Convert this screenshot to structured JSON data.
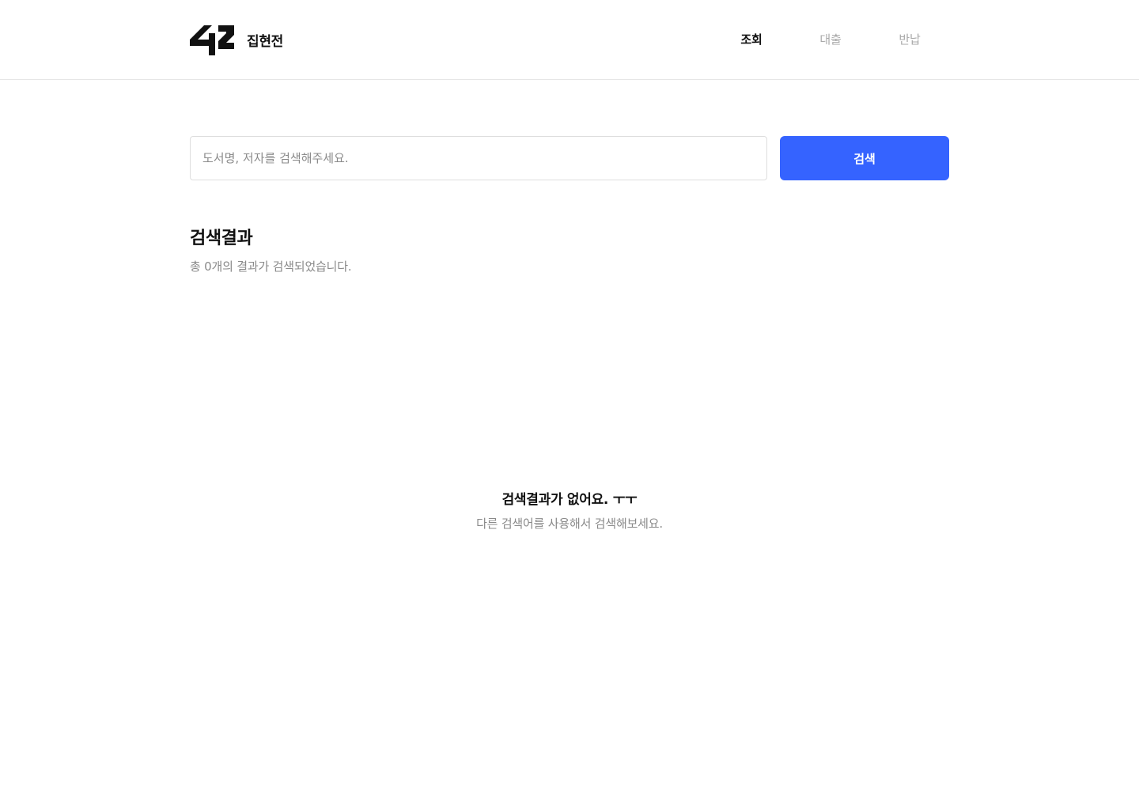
{
  "header": {
    "logo_icon": "42-logo",
    "brand_name": "집현전",
    "nav": [
      {
        "label": "조회",
        "active": true
      },
      {
        "label": "대출",
        "active": false
      },
      {
        "label": "반납",
        "active": false
      }
    ]
  },
  "search": {
    "placeholder": "도서명, 저자를 검색해주세요.",
    "value": "",
    "button_label": "검색"
  },
  "results": {
    "title": "검색결과",
    "count_text": "총 0개의 결과가 검색되었습니다."
  },
  "empty_state": {
    "title": "검색결과가 없어요. ㅜㅜ",
    "description": "다른 검색어를 사용해서 검색해보세요."
  },
  "colors": {
    "accent": "#3563ff",
    "muted_text": "#8a8a8a",
    "inactive_nav": "#a9a9a9",
    "border": "#dedede"
  }
}
